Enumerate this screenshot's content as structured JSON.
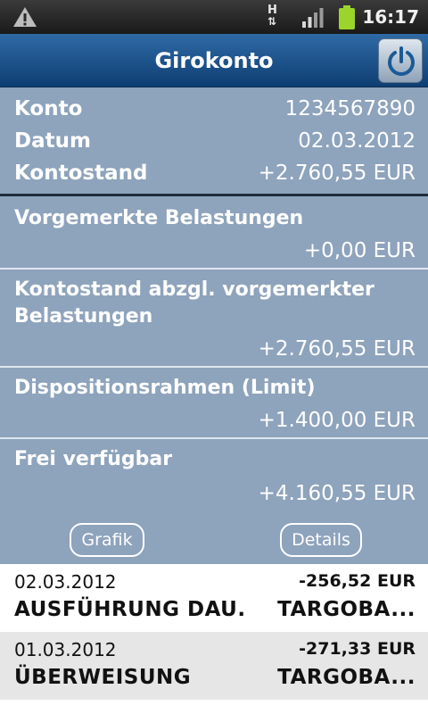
{
  "status_bar": {
    "time": "16:17",
    "network_indicator": "H",
    "icons": [
      "warning-icon",
      "h-network-icon",
      "signal-icon",
      "battery-icon"
    ],
    "battery_color": "#9bd42a"
  },
  "header": {
    "title": "Girokonto",
    "power_icon": "power-icon"
  },
  "account": {
    "konto_label": "Konto",
    "konto_value": "1234567890",
    "datum_label": "Datum",
    "datum_value": "02.03.2012",
    "kontostand_label": "Kontostand",
    "kontostand_value": "+2.760,55 EUR"
  },
  "sections": [
    {
      "label": "Vorgemerkte Belastungen",
      "value": "+0,00 EUR"
    },
    {
      "label_line1": "Kontostand abzgl. vorgemerkter",
      "label_line2": "Belastungen",
      "value": "+2.760,55 EUR"
    },
    {
      "label": "Dispositionsrahmen (Limit)",
      "value": "+1.400,00 EUR"
    },
    {
      "label": "Frei verfügbar",
      "value": "+4.160,55 EUR"
    }
  ],
  "buttons": {
    "grafik": "Grafik",
    "details": "Details"
  },
  "transactions": [
    {
      "date": "02.03.2012",
      "amount": "-256,52 EUR",
      "type": "AUSFÜHRUNG DAU.",
      "partner": "TARGOBA..."
    },
    {
      "date": "01.03.2012",
      "amount": "-271,33 EUR",
      "type": "ÜBERWEISUNG",
      "partner": "TARGOBA..."
    }
  ],
  "colors": {
    "header": "#1f5490",
    "panel": "#8ea3bc",
    "row_alt": "#e6e6e6"
  }
}
